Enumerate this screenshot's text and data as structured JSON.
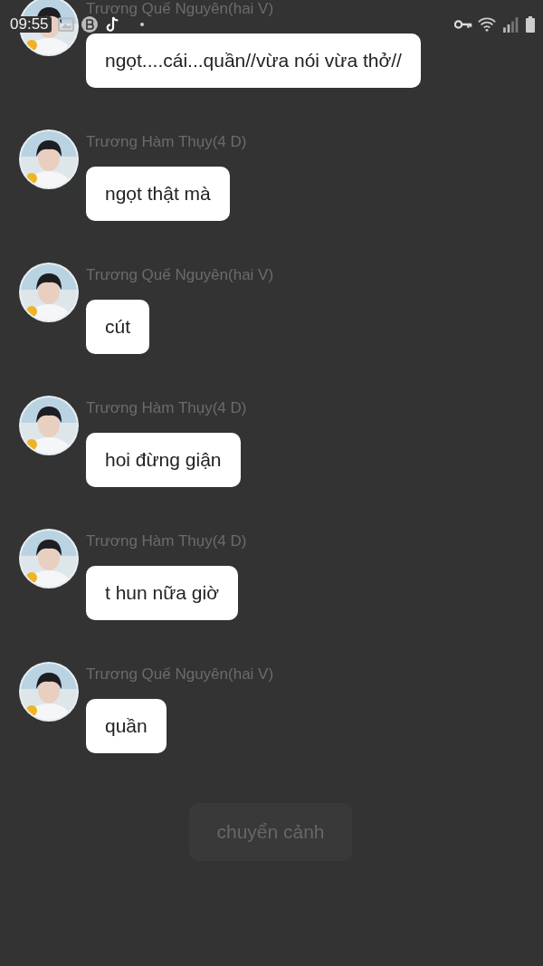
{
  "status_bar": {
    "time": "09:55"
  },
  "messages": [
    {
      "sender": "Trương Quế Nguyên(hai V)",
      "text": "ngọt....cái...quần//vừa nói vừa thở//"
    },
    {
      "sender": "Trương Hàm Thụy(4 D)",
      "text": "ngọt thật mà"
    },
    {
      "sender": "Trương Quế Nguyên(hai V)",
      "text": "cút"
    },
    {
      "sender": "Trương Hàm Thụy(4 D)",
      "text": "hoi đừng giận"
    },
    {
      "sender": "Trương Hàm Thụy(4 D)",
      "text": "t hun nữa giờ"
    },
    {
      "sender": "Trương Quế Nguyên(hai V)",
      "text": "quần"
    }
  ],
  "action_button": {
    "label": "chuyển cảnh",
    "disabled": true
  }
}
